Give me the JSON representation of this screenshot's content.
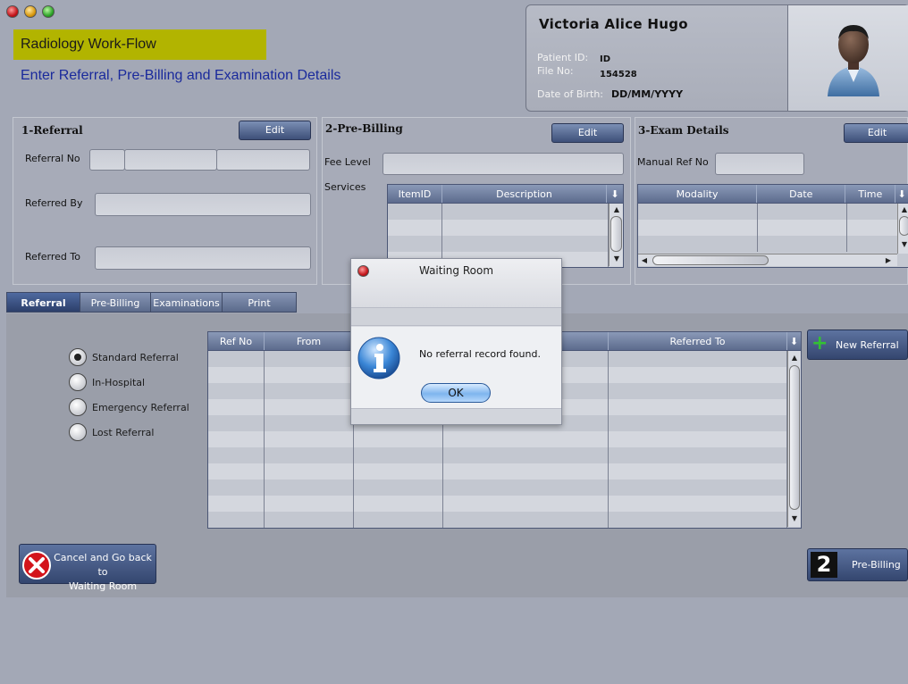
{
  "window": {
    "controls": [
      "close",
      "minimize",
      "maximize"
    ]
  },
  "header": {
    "app_title": "Radiology Work-Flow",
    "subtitle": "Enter Referral, Pre-Billing and Examination Details"
  },
  "patient": {
    "name": "Victoria Alice Hugo",
    "id_label": "Patient ID:",
    "id_value": "ID",
    "file_label": "File No:",
    "file_value": "154528",
    "dob_label": "Date of Birth:",
    "dob_value": "DD/MM/YYYY",
    "photo_icon": "user-avatar-icon"
  },
  "referral_panel": {
    "title": "1-Referral",
    "edit_label": "Edit",
    "referral_no_label": "Referral No",
    "referred_by_label": "Referred By",
    "referred_to_label": "Referred  To"
  },
  "prebilling_panel": {
    "title": "2-Pre-Billing",
    "edit_label": "Edit",
    "fee_level_label": "Fee Level",
    "services_label": "Services",
    "columns": [
      "ItemID",
      "Description"
    ]
  },
  "exam_panel": {
    "title": "3-Exam Details",
    "edit_label": "Edit",
    "manual_ref_label": "Manual Ref No",
    "columns": [
      "Modality",
      "Date",
      "Time"
    ]
  },
  "tabs": [
    {
      "label": "Referral",
      "active": true
    },
    {
      "label": "Pre-Billing",
      "active": false
    },
    {
      "label": "Examinations",
      "active": false
    },
    {
      "label": "Print",
      "active": false
    }
  ],
  "referral_types": [
    {
      "label": "Standard Referral",
      "selected": true
    },
    {
      "label": "In-Hospital",
      "selected": false
    },
    {
      "label": "Emergency Referral",
      "selected": false
    },
    {
      "label": "Lost Referral",
      "selected": false
    }
  ],
  "referral_table": {
    "columns": [
      "Ref No",
      "From",
      "",
      "",
      "Referred To"
    ]
  },
  "buttons": {
    "new_referral": "New Referral",
    "cancel_line1": "Cancel and Go back to",
    "cancel_line2": "Waiting Room",
    "prebilling_step": "2",
    "prebilling": "Pre-Billing"
  },
  "dialog": {
    "title": "Waiting Room",
    "message": "No referral record found.",
    "ok_label": "OK"
  }
}
